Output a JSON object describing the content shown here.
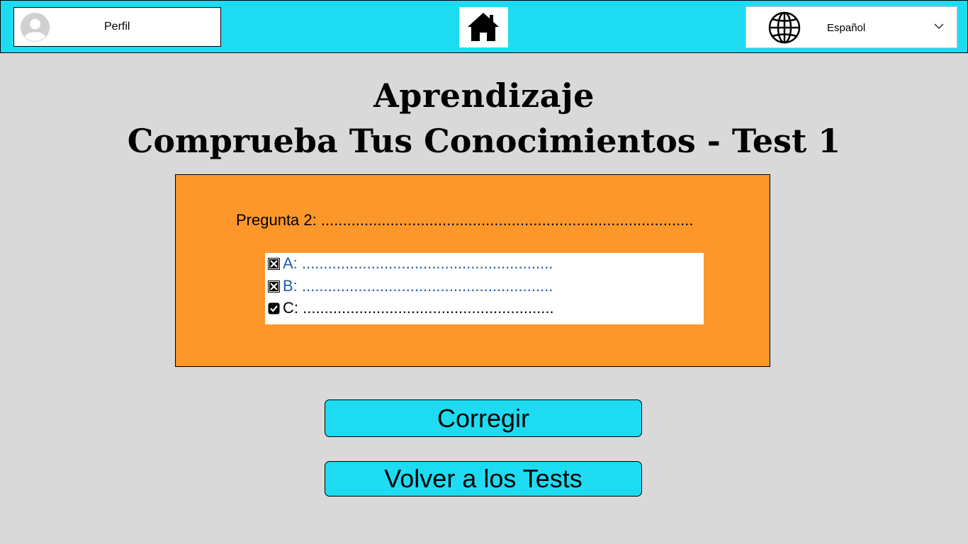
{
  "header": {
    "profile_label": "Perfil",
    "language_label": "Español"
  },
  "icons": {
    "avatar": "user-avatar-icon",
    "home": "house-icon",
    "language": "globe-icon",
    "dropdown": "chevron-down-icon",
    "checkbox_crossed": "checkbox-crossed-icon",
    "checkbox_checked": "checkbox-checked-icon"
  },
  "titles": {
    "line1": "Aprendizaje",
    "line2": "Comprueba Tus Conocimientos - Test 1"
  },
  "question": {
    "text": "Pregunta 2: ......................................................................................",
    "answers": [
      {
        "label": "A: ..........................................................",
        "state": "crossed"
      },
      {
        "label": "B: ..........................................................",
        "state": "crossed"
      },
      {
        "label": "C: ..........................................................",
        "state": "checked"
      }
    ]
  },
  "buttons": {
    "correct": "Corregir",
    "back": "Volver a los Tests"
  },
  "colors": {
    "header_bg": "#1ddcf2",
    "page_bg": "#d9d9d9",
    "panel_bg": "#fe9729",
    "button_bg": "#1ddcf2",
    "link_text": "#1f5ca8"
  }
}
